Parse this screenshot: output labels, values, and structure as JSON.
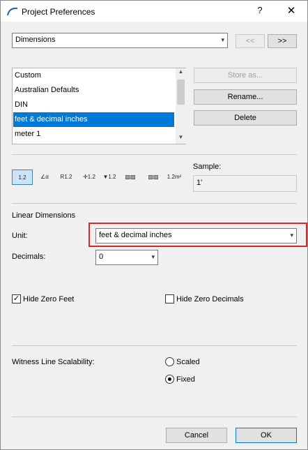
{
  "window": {
    "title": "Project Preferences",
    "help_label": "?",
    "close_label": "✕"
  },
  "category": {
    "selected": "Dimensions",
    "prev_label": "<<",
    "next_label": ">>"
  },
  "presets": {
    "items": [
      "Custom",
      "Australian Defaults",
      "DIN",
      "feet & decimal inches",
      "meter 1"
    ],
    "selected_index": 3,
    "store_label": "Store as...",
    "rename_label": "Rename...",
    "delete_label": "Delete"
  },
  "toolbar": {
    "icons": [
      {
        "name": "linear-dimension-icon",
        "glyph": "1.2"
      },
      {
        "name": "angle-dimension-icon",
        "glyph": "∠α"
      },
      {
        "name": "radial-dimension-icon",
        "glyph": "R1.2"
      },
      {
        "name": "level-dimension-icon",
        "glyph": "✛1.2"
      },
      {
        "name": "elevation-dimension-icon",
        "glyph": "▼1.2"
      },
      {
        "name": "door-window-dimension-icon",
        "glyph": "▨▨"
      },
      {
        "name": "sill-height-dimension-icon",
        "glyph": "▨▨"
      },
      {
        "name": "area-calculation-icon",
        "glyph": "1.2m²"
      }
    ],
    "sample_label": "Sample:",
    "sample_value": "1'"
  },
  "linear": {
    "section_title": "Linear Dimensions",
    "unit_label": "Unit:",
    "unit_value": "feet & decimal inches",
    "decimals_label": "Decimals:",
    "decimals_value": "0",
    "hide_zero_feet_label": "Hide Zero Feet",
    "hide_zero_feet_checked": true,
    "hide_zero_decimals_label": "Hide Zero Decimals",
    "hide_zero_decimals_checked": false
  },
  "witness": {
    "label": "Witness Line Scalability:",
    "scaled_label": "Scaled",
    "fixed_label": "Fixed",
    "selected": "Fixed"
  },
  "footer": {
    "cancel_label": "Cancel",
    "ok_label": "OK"
  },
  "colors": {
    "selection": "#0078d7",
    "highlight": "#d9262b"
  }
}
